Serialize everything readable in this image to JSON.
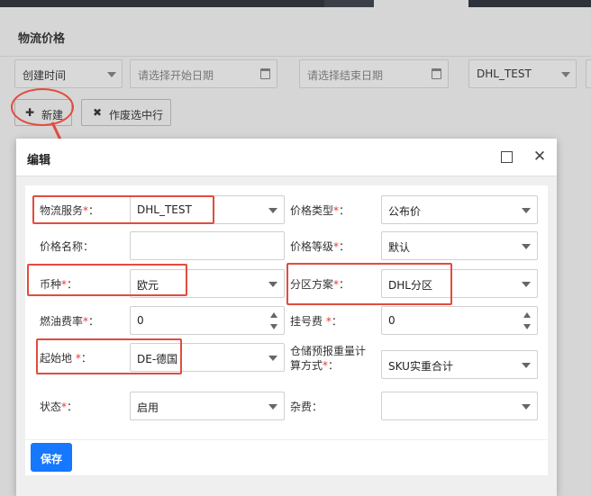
{
  "page": {
    "title": "物流价格",
    "filters": {
      "time_type": "创建时间",
      "start_date_placeholder": "请选择开始日期",
      "end_date_placeholder": "请选择结束日期",
      "service": "DHL_TEST"
    },
    "toolbar": {
      "new_label": "新建",
      "void_label": "作废选中行"
    }
  },
  "modal": {
    "title": "编辑",
    "fields": {
      "logistics_service": {
        "label": "物流服务",
        "value": "DHL_TEST"
      },
      "price_type": {
        "label": "价格类型",
        "value": "公布价"
      },
      "price_name": {
        "label": "价格名称",
        "value": ""
      },
      "price_level": {
        "label": "价格等级",
        "value": "默认"
      },
      "currency": {
        "label": "币种",
        "value": "欧元"
      },
      "zone_plan": {
        "label": "分区方案",
        "value": "DHL分区"
      },
      "fuel_rate": {
        "label": "燃油费率",
        "value": "0"
      },
      "registration_fee": {
        "label": "挂号费",
        "value": "0"
      },
      "origin": {
        "label": "起始地",
        "value": "DE-德国"
      },
      "storage_forecast_line1": "仓储预报重量计",
      "storage_forecast_line2": "算方式",
      "storage_forecast_value": "SKU实重合计",
      "status": {
        "label": "状态",
        "value": "启用"
      },
      "misc_fee": {
        "label": "杂费",
        "value": ""
      }
    },
    "required_mark": "*",
    "colon": "：",
    "save_label": "保存"
  },
  "colors": {
    "annotation": "#e24c3e",
    "primary": "#1677ff",
    "required": "#e53935"
  }
}
